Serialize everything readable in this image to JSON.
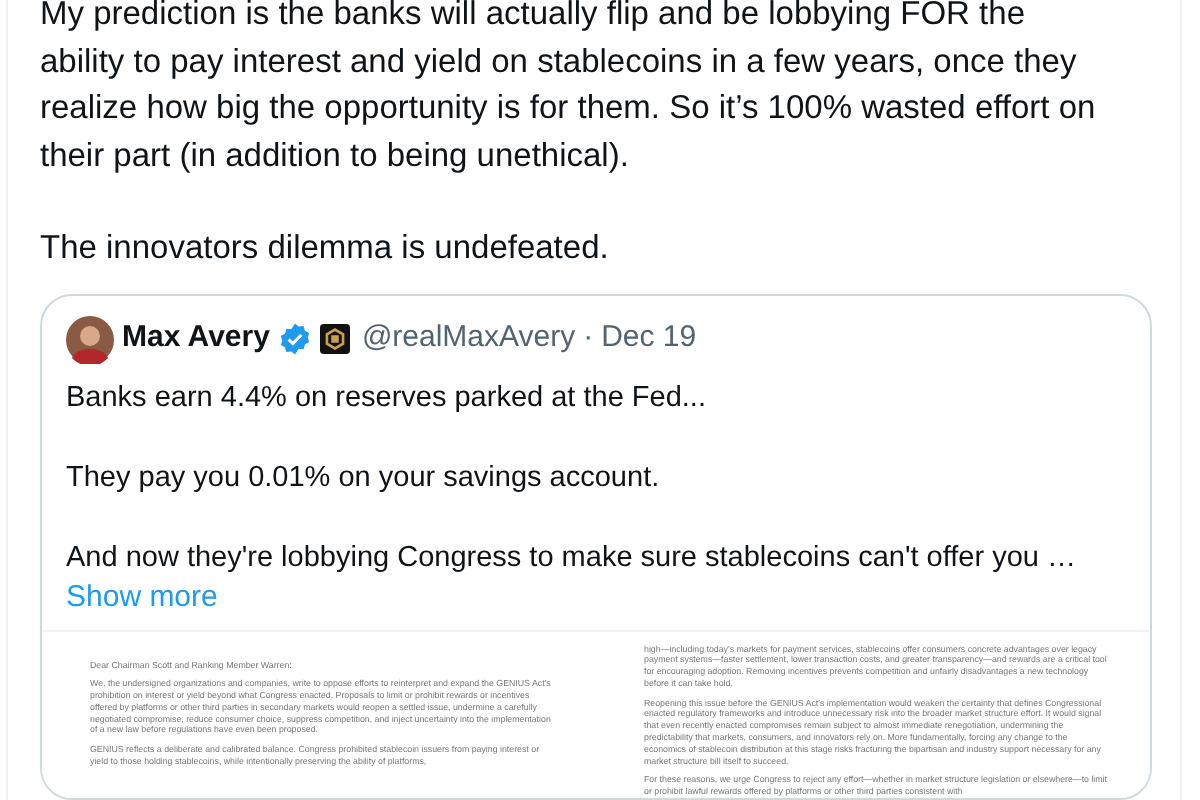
{
  "post": {
    "paragraphs": [
      "My prediction is the banks will actually flip and be lobbying FOR the ability to pay interest and yield on stablecoins in a few years, once they realize how big the opportunity is for them. So it’s 100% wasted effort on their part (in addition to being unethical).",
      "The innovators dilemma is undefeated."
    ]
  },
  "quote": {
    "name": "Max Avery",
    "verified": true,
    "handle": "@realMaxAvery",
    "separator": "·",
    "date": "Dec 19",
    "paragraphs": [
      "Banks earn 4.4% on reserves parked at the Fed...",
      "They pay you 0.01% on your savings account.",
      "And now they're lobbying Congress to make sure stablecoins can't offer you …"
    ],
    "show_more": "Show more",
    "document_pages": [
      {
        "paragraphs": [
          "Dear Chairman Scott and Ranking Member Warren:",
          "We, the undersigned organizations and companies, write to oppose efforts to reinterpret and expand the GENIUS Act's prohibition on interest or yield beyond what Congress enacted. Proposals to limit or prohibit rewards or incentives offered by platforms or other third parties in secondary markets would reopen a settled issue, undermine a carefully negotiated compromise, reduce consumer choice, suppress competition, and inject uncertainty into the implementation of a new law before regulations have even been proposed.",
          "GENIUS reflects a deliberate and calibrated balance. Congress prohibited stablecoin issuers from paying interest or yield to those holding stablecoins, while intentionally preserving the ability of platforms,"
        ]
      },
      {
        "paragraphs": [
          "high—including today's markets for payment services, stablecoins offer consumers concrete advantages over legacy payment systems—faster settlement, lower transaction costs, and greater transparency—and rewards are a critical tool for encouraging adoption. Removing incentives prevents competition and unfairly disadvantages a new technology before it can take hold.",
          "Reopening this issue before the GENIUS Act's implementation would weaken the certainty that defines Congressional enacted regulatory frameworks and introduce unnecessary risk into the broader market structure effort. It would signal that even recently enacted compromises remain subject to almost immediate renegotiation, undermining the predictability that markets, consumers, and innovators rely on. More fundamentally, forcing any change to the economics of stablecoin distribution at this stage risks fracturing the bipartisan and industry support necessary for any market structure bill itself to succeed.",
          "For these reasons, we urge Congress to reject any effort—whether in market structure legislation or elsewhere—to limit or prohibit lawful rewards offered by platforms or other third parties consistent with"
        ]
      }
    ]
  }
}
